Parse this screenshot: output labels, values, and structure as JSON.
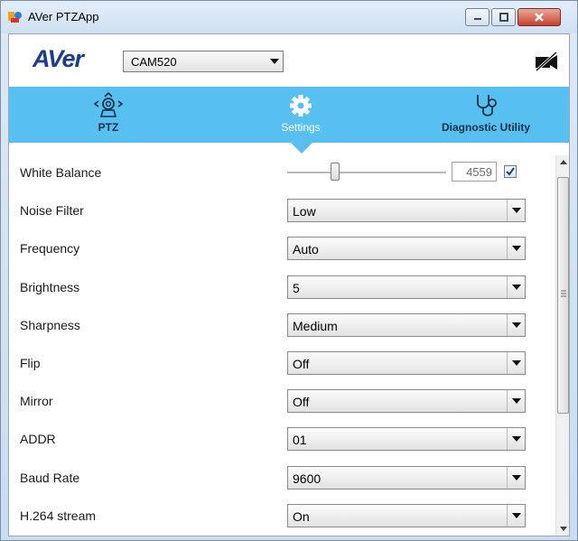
{
  "window": {
    "title": "AVer PTZApp",
    "accent": "#58c0f0"
  },
  "header": {
    "logo": "AVer",
    "camera_select": "CAM520"
  },
  "tabs": [
    {
      "label": "PTZ",
      "icon": "ptz-camera-icon",
      "active": false
    },
    {
      "label": "Settings",
      "icon": "gear-icon",
      "active": true
    },
    {
      "label": "Diagnostic Utility",
      "icon": "stethoscope-icon",
      "active": false
    }
  ],
  "settings": {
    "white_balance": {
      "label": "White Balance",
      "value": "4559",
      "auto_checked": true,
      "slider_fraction": 0.3
    },
    "rows": [
      {
        "label": "Noise Filter",
        "value": "Low"
      },
      {
        "label": "Frequency",
        "value": "Auto"
      },
      {
        "label": "Brightness",
        "value": "5"
      },
      {
        "label": "Sharpness",
        "value": "Medium"
      },
      {
        "label": "Flip",
        "value": "Off"
      },
      {
        "label": "Mirror",
        "value": "Off"
      },
      {
        "label": "ADDR",
        "value": "01"
      },
      {
        "label": "Baud Rate",
        "value": "9600"
      },
      {
        "label": "H.264 stream",
        "value": "On"
      }
    ]
  }
}
